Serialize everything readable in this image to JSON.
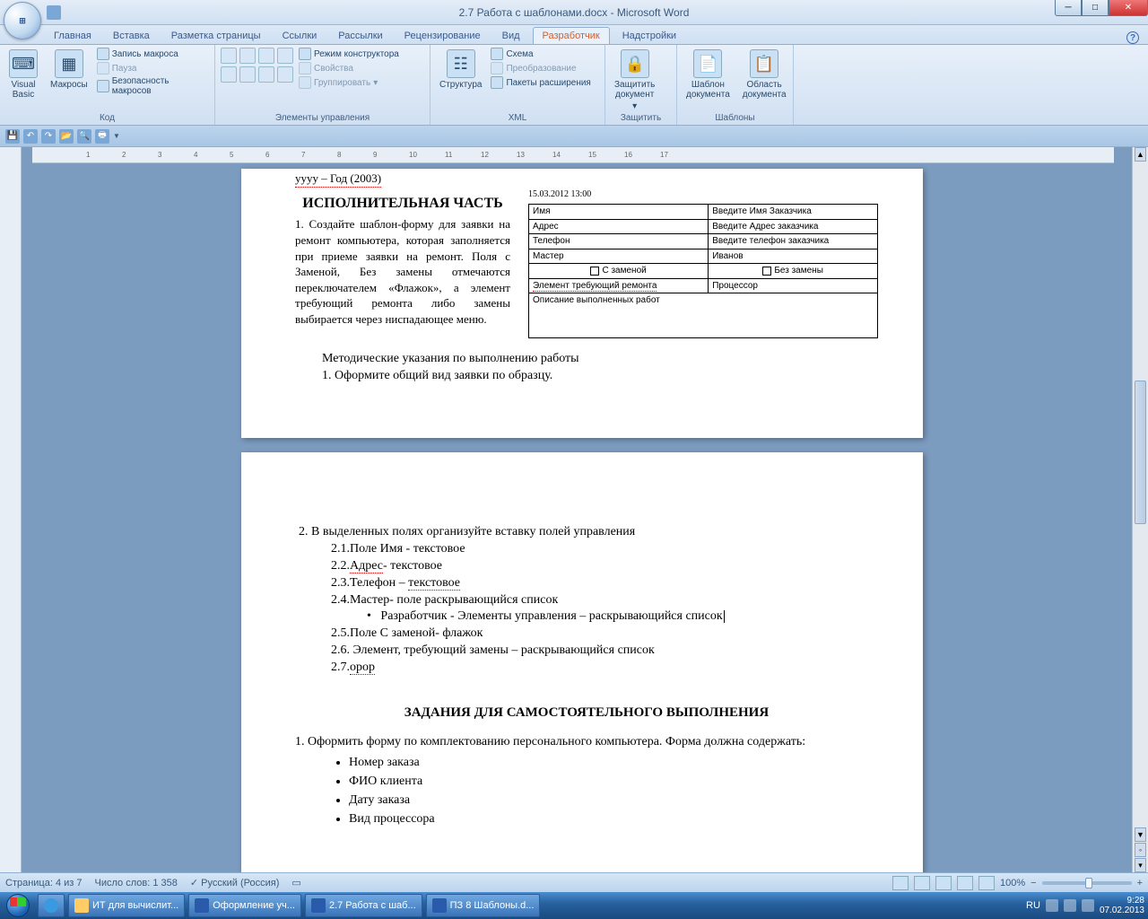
{
  "window": {
    "title": "2.7 Работа с шаблонами.docx - Microsoft Word"
  },
  "tabs": {
    "items": [
      "Главная",
      "Вставка",
      "Разметка страницы",
      "Ссылки",
      "Рассылки",
      "Рецензирование",
      "Вид",
      "Разработчик",
      "Надстройки"
    ],
    "active": "Разработчик"
  },
  "ribbon": {
    "groups": {
      "code": {
        "label": "Код",
        "vb": "Visual\nBasic",
        "macros": "Макросы",
        "record": "Запись макроса",
        "pause": "Пауза",
        "security": "Безопасность макросов"
      },
      "controls": {
        "label": "Элементы управления",
        "design": "Режим конструктора",
        "props": "Свойства",
        "group": "Группировать"
      },
      "xml": {
        "label": "XML",
        "struct": "Структура",
        "schema": "Схема",
        "transform": "Преобразование",
        "packs": "Пакеты расширения"
      },
      "protect": {
        "label": "Защитить",
        "btn": "Защитить\nдокумент"
      },
      "templates": {
        "label": "Шаблоны",
        "tpl": "Шаблон\nдокумента",
        "area": "Область\nдокумента"
      }
    }
  },
  "doc": {
    "topline": "уууу – Год (2003)",
    "heading_exec": "ИСПОЛНИТЕЛЬНАЯ ЧАСТЬ",
    "para1": "1. Создайте шаблон-форму для заявки на ремонт компьютера, которая заполняется при приеме заявки на ремонт. Поля с Заменой, Без замены отмечаются переключателем «Флажок», а элемент требующий ремонта либо замены выбирается через ниспадающее меню.",
    "form": {
      "date": "15.03.2012 13:00",
      "rows": [
        [
          "Имя",
          "Введите Имя Заказчика"
        ],
        [
          "Адрес",
          "Введите Адрес заказчика"
        ],
        [
          "Телефон",
          "Введите телефон заказчика"
        ],
        [
          "Мастер",
          "Иванов"
        ]
      ],
      "chk1": "С заменой",
      "chk2": "Без замены",
      "elem_l": "Элемент требующий ремонта",
      "elem_r": "Процессор",
      "desc": "Описание выполненных работ"
    },
    "method_title": "Методические указания по выполнению работы",
    "method_1": "1.  Оформите общий вид заявки по образцу.",
    "p2": {
      "line": "2.  В выделенных полях организуйте вставку полей управления",
      "s1": "2.1.Поле Имя - текстовое",
      "s2": "2.2.Адрес- текстовое",
      "s3": "2.3.Телефон – текстовое",
      "s4": "2.4.Мастер- поле раскрывающийся список",
      "bul": "Разработчик - Элементы управления – раскрывающийся список",
      "s5": "2.5.Поле С заменой- флажок",
      "s6": "2.6. Элемент, требующий замены – раскрывающийся список",
      "s7": "2.7.орор"
    },
    "heading_tasks": "ЗАДАНИЯ ДЛЯ САМОСТОЯТЕЛЬНОГО ВЫПОЛНЕНИЯ",
    "task1": "1.  Оформить форму по комплектованию персонального компьютера. Форма должна содержать:",
    "task_items": [
      "Номер заказа",
      "ФИО клиента",
      "Дату заказа",
      "Вид процессора"
    ]
  },
  "status": {
    "page": "Страница: 4 из 7",
    "words": "Число слов: 1 358",
    "lang": "Русский (Россия)",
    "zoom": "100%"
  },
  "taskbar": {
    "items": [
      "ИТ для вычислит...",
      "Оформление уч...",
      "2.7 Работа с шаб...",
      "ПЗ 8 Шаблоны.d..."
    ],
    "lang": "RU",
    "time": "9:28",
    "date": "07.02.2013"
  }
}
